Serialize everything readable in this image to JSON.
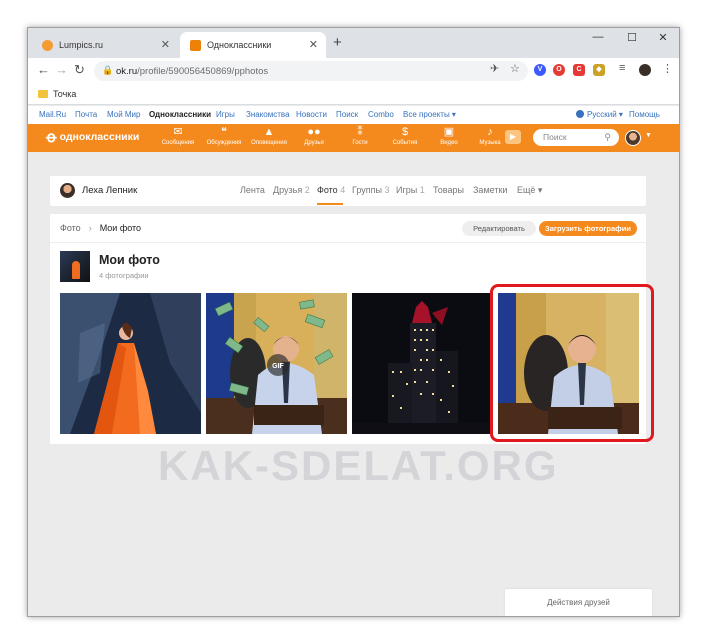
{
  "browser": {
    "tabs": [
      {
        "title": "Lumpics.ru",
        "active": false,
        "favicon_color": "#f39c32"
      },
      {
        "title": "Одноклассники",
        "active": true,
        "favicon_color": "#ee8208"
      }
    ],
    "new_tab": "+",
    "window_controls": {
      "minimize": "—",
      "maximize": "☐",
      "close": "✕"
    },
    "address": {
      "host": "ok.ru",
      "path": "/profile/590056450869/pphotos"
    },
    "bookmarks": [
      {
        "label": "Точка"
      }
    ],
    "extensions": [
      {
        "name": "translate-icon",
        "glyph": "✈",
        "color": "#444"
      },
      {
        "name": "star-icon",
        "glyph": "☆",
        "color": "#555"
      },
      {
        "name": "vpn-icon",
        "glyph": "V",
        "color": "#3d5afe"
      },
      {
        "name": "opera-icon",
        "glyph": "O",
        "color": "#e53935"
      },
      {
        "name": "csg-icon",
        "glyph": "C",
        "color": "#e53935"
      },
      {
        "name": "shield-icon",
        "glyph": "◆",
        "color": "#8a6d1b"
      },
      {
        "name": "menu-lines-icon",
        "glyph": "≡",
        "color": "#555"
      }
    ]
  },
  "ok_links": {
    "items": [
      "Mail.Ru",
      "Почта",
      "Мой Мир",
      "Одноклассники",
      "Игры",
      "Знакомства",
      "Новости",
      "Поиск",
      "Combo",
      "Все проекты ▾"
    ],
    "current_index": 3,
    "language": "Русский ▾",
    "help": "Помощь"
  },
  "ok_header": {
    "logo_text": "одноклассники",
    "nav": [
      {
        "label": "Сообщения",
        "icon": "✉"
      },
      {
        "label": "Обсуждения",
        "icon": "💬"
      },
      {
        "label": "Оповещения",
        "icon": "🔔"
      },
      {
        "label": "Друзья",
        "icon": "👥"
      },
      {
        "label": "Гости",
        "icon": "👣"
      },
      {
        "label": "События",
        "icon": "$"
      },
      {
        "label": "Видео",
        "icon": "🎥"
      },
      {
        "label": "Музыка",
        "icon": "♪"
      }
    ],
    "search_placeholder": "Поиск",
    "accent_color": "#f48a1e"
  },
  "profile": {
    "name": "Леха Лепник",
    "tabs": [
      {
        "label": "Лента",
        "count": ""
      },
      {
        "label": "Друзья",
        "count": "2"
      },
      {
        "label": "Фото",
        "count": "4"
      },
      {
        "label": "Группы",
        "count": "3"
      },
      {
        "label": "Игры",
        "count": "1"
      },
      {
        "label": "Товары",
        "count": ""
      },
      {
        "label": "Заметки",
        "count": ""
      },
      {
        "label": "Ещё ▾",
        "count": ""
      }
    ],
    "active_tab_index": 2
  },
  "album": {
    "breadcrumb": [
      "Фото",
      "Мои фото"
    ],
    "edit_label": "Редактировать",
    "upload_label": "Загрузить фотографии",
    "title": "Мои фото",
    "count_text": "4 фотографии",
    "photos": [
      {
        "subject": "woman-orange-dress"
      },
      {
        "subject": "man-money-gif",
        "badge": "GIF"
      },
      {
        "subject": "night-skyscraper"
      },
      {
        "subject": "man-office-desk",
        "highlighted": true
      }
    ]
  },
  "watermark": "KAK-SDELAT.ORG",
  "friends_actions": "Действия друзей"
}
